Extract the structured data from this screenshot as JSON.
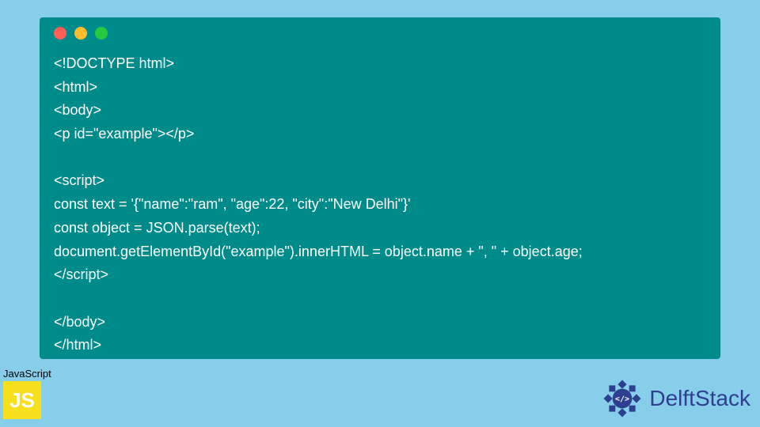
{
  "code": {
    "lines": [
      "<!DOCTYPE html>",
      "<html>",
      "<body>",
      "<p id=\"example\"></p>",
      "",
      "<script>",
      "const text = '{\"name\":\"ram\", \"age\":22, \"city\":\"New Delhi\"}'",
      "const object = JSON.parse(text);",
      "document.getElementById(\"example\").innerHTML = object.name + \", \" + object.age;",
      "</script>",
      "",
      "</body>",
      "</html>"
    ]
  },
  "badge": {
    "language_label": "JavaScript",
    "language_icon_text": "JS"
  },
  "brand": {
    "name": "DelftStack"
  },
  "window_controls": {
    "red": "#ff5f56",
    "yellow": "#ffbd2e",
    "green": "#27c93f"
  }
}
